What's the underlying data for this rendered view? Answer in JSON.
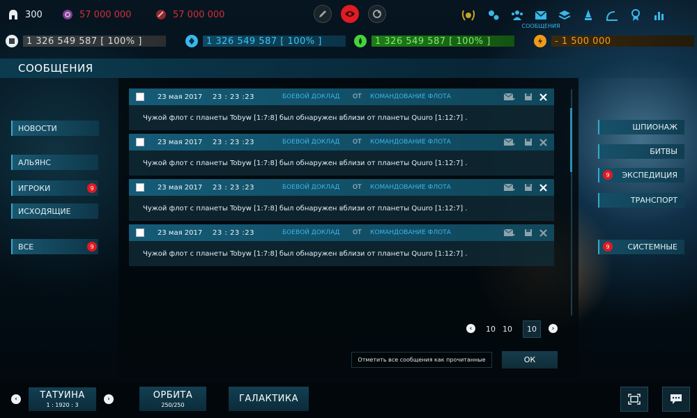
{
  "top_stats": {
    "stat1": "300",
    "stat2": "57 000 000",
    "stat3": "57 000 000"
  },
  "top_nav": {
    "messages_label": "сообщения"
  },
  "resources": {
    "metal": "1 326 549 587 [ 100% ]",
    "crystal": "1 326 549 587 [ 100% ]",
    "deuterium": "1 326 549 587 [ 100% ]",
    "energy": "- 1 500 000"
  },
  "page": {
    "title": "СООБЩЕНИЯ"
  },
  "left_nav": [
    {
      "label": "НОВОСТИ",
      "badge": ""
    },
    {
      "label": "АЛЬЯНС",
      "badge": ""
    },
    {
      "label": "ИГРОКИ",
      "badge": "9"
    },
    {
      "label": "ИСХОДЯЩИЕ",
      "badge": ""
    },
    {
      "label": "ВСЕ",
      "badge": "9"
    }
  ],
  "right_nav": [
    {
      "label": "ШПИОНАЖ",
      "badge": ""
    },
    {
      "label": "БИТВЫ",
      "badge": ""
    },
    {
      "label": "ЭКСПЕДИЦИЯ",
      "badge": "9"
    },
    {
      "label": "ТРАНСПОРТ",
      "badge": ""
    },
    {
      "label": "СИСТЕМНЫЕ",
      "badge": "9"
    }
  ],
  "messages": [
    {
      "date": "23 мая 2017",
      "time": "23 : 23 :23",
      "type": "боевой доклад",
      "from": "от",
      "sender": "командование флота",
      "text": "Чужой флот с планеты Tobyw [1:7:8] был обнаружен вблизи от планеты Quuro [1:12:7] ."
    },
    {
      "date": "23 мая 2017",
      "time": "23 : 23 :23",
      "type": "боевой доклад",
      "from": "от",
      "sender": "командование флота",
      "text": "Чужой флот с планеты Tobyw [1:7:8] был обнаружен вблизи от планеты Quuro [1:12:7] ."
    },
    {
      "date": "23 мая 2017",
      "time": "23 : 23 :23",
      "type": "боевой доклад",
      "from": "от",
      "sender": "командование флота",
      "text": "Чужой флот с планеты Tobyw [1:7:8] был обнаружен вблизи от планеты Quuro [1:12:7] ."
    },
    {
      "date": "23 мая 2017",
      "time": "23 : 23 :23",
      "type": "боевой доклад",
      "from": "от",
      "sender": "командование флота",
      "text": "Чужой флот с планеты Tobyw [1:7:8] был обнаружен вблизи от планеты Quuro [1:12:7] ."
    }
  ],
  "pagination": {
    "page_a": "10",
    "page_b": "10",
    "page_current": "10"
  },
  "actions": {
    "mark_all_read": "Отметить все сообщения как прочитанные",
    "ok": "ОК"
  },
  "bottom": {
    "planet_name": "ТАТУИНА",
    "planet_coords": "1 : 1920 : 3",
    "orbit_label": "ОРБИТА",
    "orbit_value": "250/250",
    "galaxy_label": "ГАЛАКТИКА"
  },
  "colors": {
    "accent": "#3ab7ea",
    "alert_red": "#e01a22",
    "metal_bar": "#3a3f41",
    "crystal_bar": "#0e4a63",
    "deuterium_bar": "#1e7c1a",
    "energy_bar": "#3a2a10"
  }
}
